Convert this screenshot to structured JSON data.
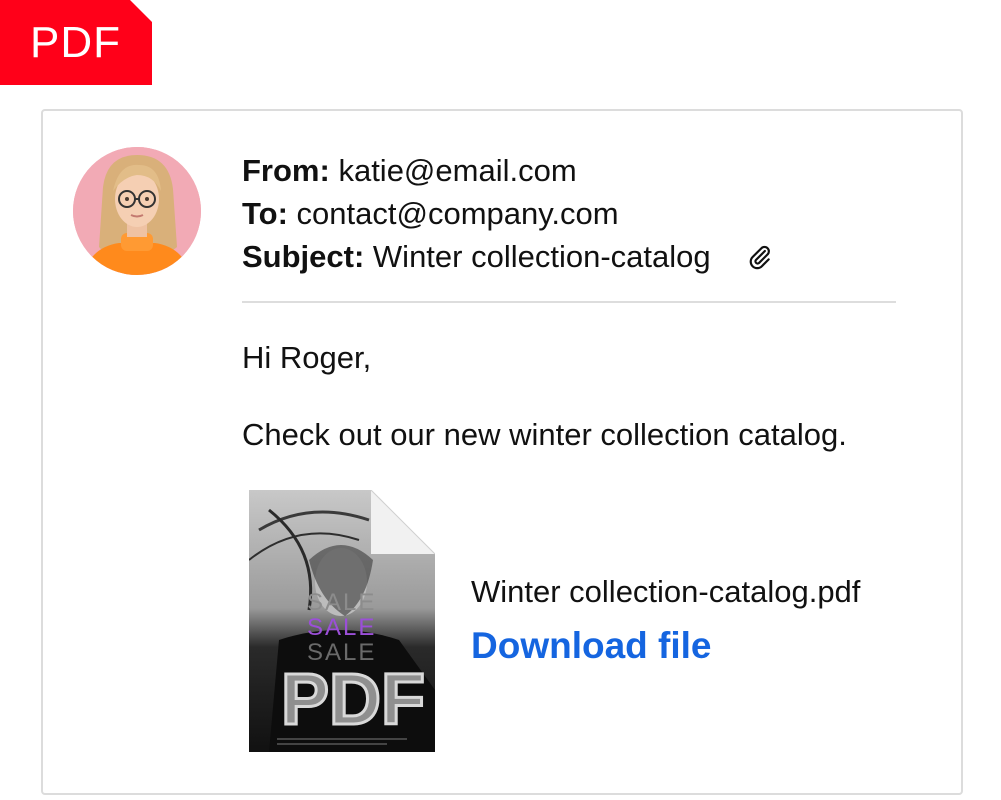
{
  "badge": {
    "label": "PDF"
  },
  "email": {
    "from_label": "From:",
    "from_value": "katie@email.com",
    "to_label": "To:",
    "to_value": "contact@company.com",
    "subject_label": "Subject:",
    "subject_value": "Winter collection-catalog",
    "attachment_icon": "paperclip-icon",
    "greeting": "Hi Roger,",
    "body": "Check out our new winter collection catalog."
  },
  "attachment": {
    "thumbnail": {
      "sale_lines": [
        "SALE",
        "SALE",
        "SALE"
      ],
      "overlay_label": "PDF"
    },
    "file_name": "Winter collection-catalog.pdf",
    "download_label": "Download file"
  },
  "colors": {
    "badge": "#ff0019",
    "link": "#1565e0",
    "sale_accent": "#9b4fd8",
    "avatar_bg": "#f2aab5",
    "sweater": "#ff8a1c"
  }
}
